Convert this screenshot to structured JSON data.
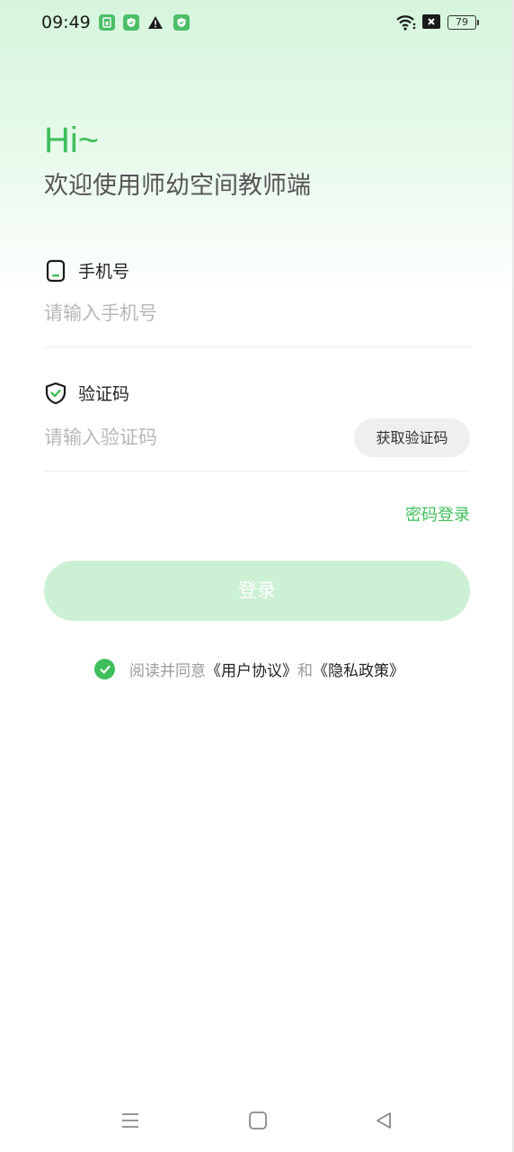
{
  "status_bar": {
    "time": "09:49",
    "battery": "79",
    "left_icons": [
      "sim-icon",
      "shield-icon",
      "warning-icon",
      "shield-icon"
    ],
    "right_icons": [
      "wifi-icon",
      "no-signal-icon",
      "battery-icon"
    ]
  },
  "header": {
    "greeting": "Hi~",
    "welcome": "欢迎使用师幼空间教师端"
  },
  "phone": {
    "label": "手机号",
    "placeholder": "请输入手机号",
    "value": ""
  },
  "code": {
    "label": "验证码",
    "placeholder": "请输入验证码",
    "value": "",
    "get_code_button": "获取验证码"
  },
  "password_login_link": "密码登录",
  "login_button": "登录",
  "agreement": {
    "checked": true,
    "prefix": "阅读并同意",
    "user_agreement": "《用户协议》",
    "and": "和",
    "privacy_policy": "《隐私政策》"
  },
  "nav_bar": {
    "icons": [
      "menu-icon",
      "home-icon",
      "back-icon"
    ]
  },
  "colors": {
    "accent": "#3fbf5c",
    "login_button_disabled": "#ccf0d4",
    "gradient_top": "#d6f5dc"
  }
}
